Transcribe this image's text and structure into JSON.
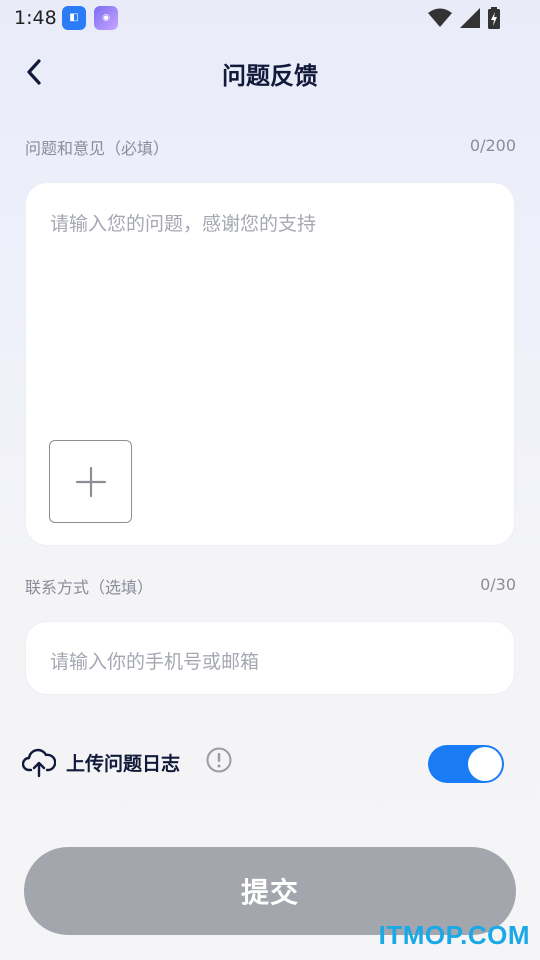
{
  "status_bar": {
    "time": "1:48",
    "app_icons": [
      "app-icon-1",
      "app-icon-2"
    ],
    "icons": [
      "wifi-icon",
      "signal-icon",
      "battery-icon"
    ]
  },
  "header": {
    "title": "问题反馈",
    "back_icon": "chevron-left-icon"
  },
  "feedback": {
    "label": "问题和意见（必填）",
    "count": "0/200",
    "placeholder": "请输入您的问题，感谢您的支持",
    "add_icon": "plus-icon"
  },
  "contact": {
    "label": "联系方式（选填）",
    "count": "0/30",
    "placeholder": "请输入你的手机号或邮箱"
  },
  "upload_log": {
    "icon": "cloud-upload-icon",
    "label": "上传问题日志",
    "info_icon": "info-icon",
    "enabled": true
  },
  "submit": {
    "label": "提交"
  },
  "watermark": "ITMOP.COM",
  "colors": {
    "accent": "#1a7cf5",
    "title": "#121a3a",
    "placeholder": "#a5a8b2",
    "submit_disabled": "#a4a6ae",
    "watermark": "#1aa9e6"
  }
}
